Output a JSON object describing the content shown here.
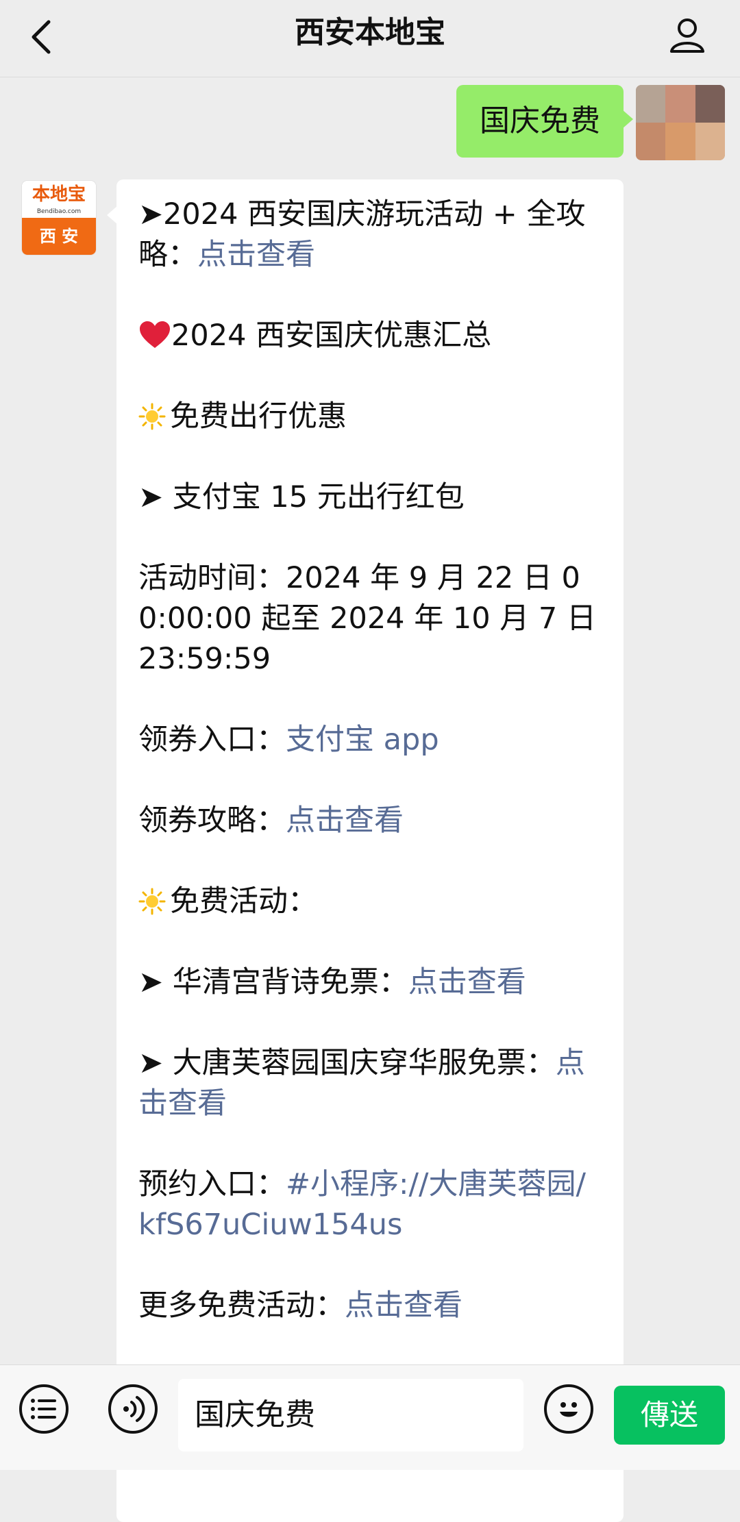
{
  "header": {
    "title": "西安本地宝"
  },
  "outgoing_message": {
    "text": "国庆免费"
  },
  "incoming_message": {
    "avatar_text_top": "本地宝",
    "avatar_text_sub": "Bendibao.com",
    "avatar_text_bottom": "西 安",
    "lines": {
      "l1_text": "➤2024 西安国庆游玩活动 + 全攻略：",
      "l1_link": "点击查看",
      "l2_text": "2024 西安国庆优惠汇总",
      "l3_text": "免费出行优惠",
      "l4_text": "➤ 支付宝 15 元出行红包",
      "l5_text": "活动时间：2024 年 9 月 22 日 00:00:00 起至 2024 年 10 月 7 日 23:59:59",
      "l6_text": "领券入口：",
      "l6_link": "支付宝 app",
      "l7_text": "领券攻略：",
      "l7_link": "点击查看",
      "l8_text": "免费活动：",
      "l9_text": "➤ 华清宫背诗免票：",
      "l9_link": "点击查看",
      "l10_text": "➤ 大唐芙蓉园国庆穿华服免票：",
      "l10_link": "点击查看",
      "l11_text": "预约入口：",
      "l11_link": "#小程序://大唐芙蓉园/kfS67uCiuw154us",
      "l12_text": "更多免费活动：",
      "l12_link": "点击查看"
    }
  },
  "input_bar": {
    "input_value": "国庆免费",
    "send_label": "傳送"
  },
  "icons": {
    "back": "chevron-left-icon",
    "profile": "person-icon",
    "menu": "menu-list-icon",
    "voice": "voice-icon",
    "emoji": "emoji-icon",
    "heart": "heart-icon",
    "sun": "sun-icon"
  },
  "colors": {
    "outgoing_bubble": "#95ec69",
    "link": "#576b95",
    "send_button": "#07c160",
    "logo_orange": "#f06a14"
  }
}
